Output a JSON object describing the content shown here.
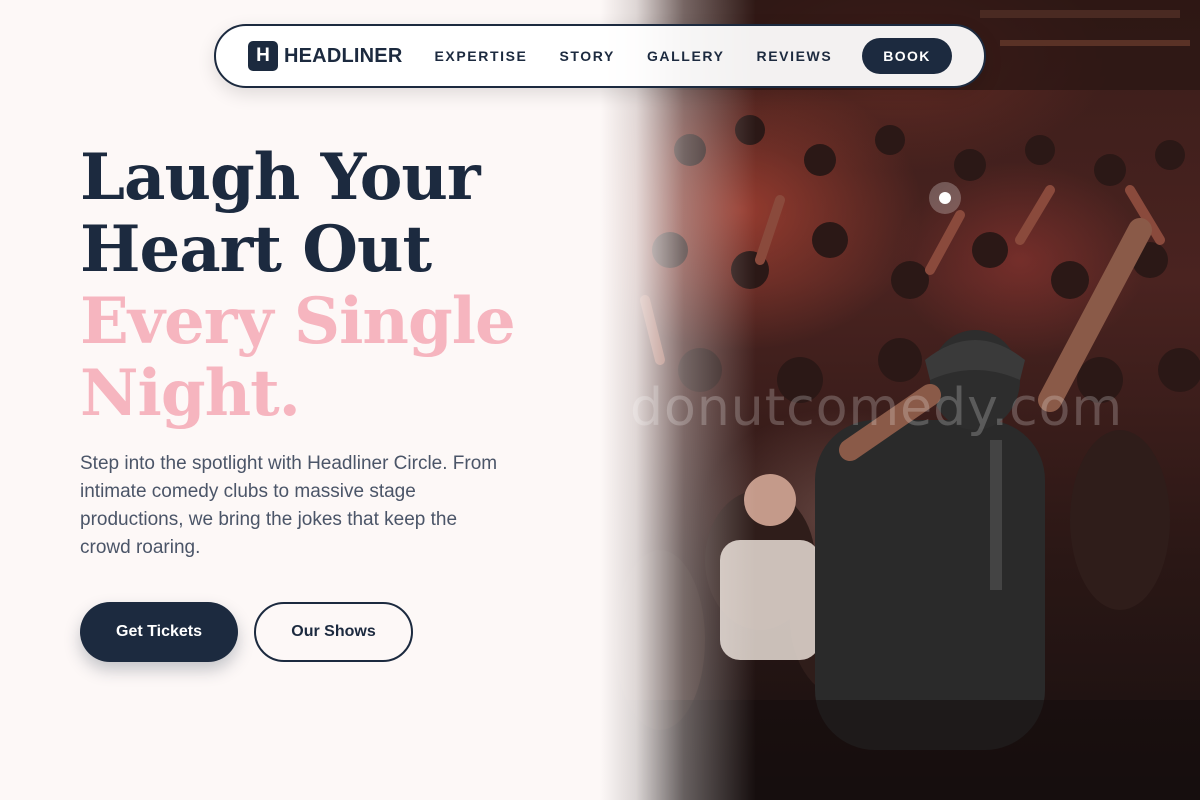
{
  "colors": {
    "navy": "#1c2a3f",
    "pink": "#f6b5bf",
    "background": "#fdf8f7",
    "body_text": "#4b5568"
  },
  "nav": {
    "logo_mark": "H",
    "logo_text": "HEADLINER",
    "links": [
      "EXPERTISE",
      "STORY",
      "GALLERY",
      "REVIEWS"
    ],
    "cta_label": "BOOK"
  },
  "hero": {
    "headline_lines": [
      "Laugh Your",
      "Heart Out"
    ],
    "accent_lines": [
      "Every Single",
      "Night."
    ],
    "lede": "Step into the spotlight with Headliner Circle. From intimate comedy clubs to massive stage productions, we bring the jokes that keep the crowd roaring.",
    "primary_button": "Get Tickets",
    "secondary_button": "Our Shows",
    "photo_watermark": "donutcomedy.com"
  }
}
